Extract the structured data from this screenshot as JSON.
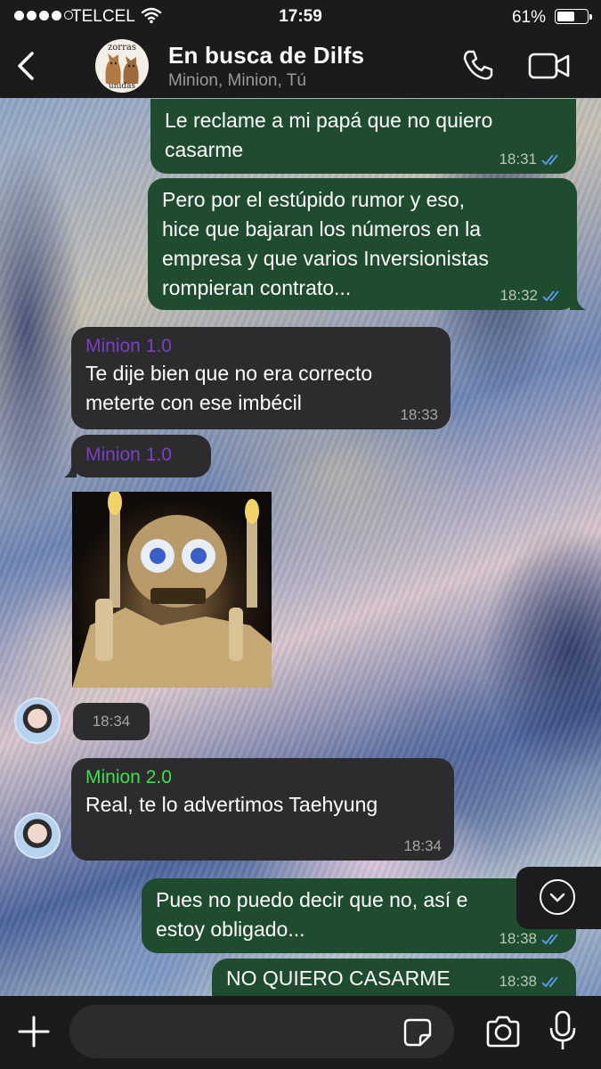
{
  "status_bar": {
    "carrier": "TELCEL",
    "time": "17:59",
    "battery_percent": "61%",
    "battery_level": 0.61,
    "signal_bars_filled": 4,
    "signal_bars_total": 5
  },
  "header": {
    "back_icon": "chevron-left-icon",
    "avatar_text_top": "zorras",
    "avatar_text_bottom": "unidas",
    "title": "En busca de Dilfs",
    "subtitle": "Minion, Minion, Tú",
    "call_icon": "phone-icon",
    "video_icon": "video-camera-icon"
  },
  "messages": [
    {
      "type": "outgoing",
      "text_lines": [
        "Le reclame a mi papá que no quiero",
        "casarme"
      ],
      "time": "18:31",
      "status": "read"
    },
    {
      "type": "outgoing",
      "text_lines": [
        "Pero por el estúpido rumor y eso,",
        "hice que bajaran los números en la",
        "empresa y que varios Inversionistas",
        "rompieran contrato..."
      ],
      "time": "18:32",
      "status": "read"
    },
    {
      "type": "incoming",
      "sender": "Minion 1.0",
      "sender_color": "#7b3fc4",
      "text_lines": [
        "Te dije bien que no era correcto",
        "meterte con ese imbécil"
      ],
      "time": "18:33"
    },
    {
      "type": "incoming-sticker",
      "sender": "Minion 1.0",
      "sender_color": "#7b3fc4",
      "time": "18:34"
    },
    {
      "type": "incoming",
      "sender": "Minion 2.0",
      "sender_color": "#3ee04a",
      "text_lines": [
        "Real, te lo advertimos Taehyung"
      ],
      "time": "18:34"
    },
    {
      "type": "outgoing",
      "text_lines": [
        "Pues no puedo decir que no, así e",
        "estoy obligado..."
      ],
      "time": "18:38",
      "status": "read"
    },
    {
      "type": "outgoing",
      "text_lines": [
        "NO QUIERO CASARME"
      ],
      "time": "18:38",
      "status": "read"
    }
  ],
  "colors": {
    "outgoing_bubble": "#1f4b2f",
    "incoming_bubble": "#2c2c2e",
    "read_ticks": "#5aa0ff",
    "bar_background": "#1b1b1b"
  },
  "input_bar": {
    "plus_icon": "plus-icon",
    "placeholder": "",
    "sticker_icon": "sticker-icon",
    "camera_icon": "camera-icon",
    "mic_icon": "microphone-icon"
  },
  "scroll_button_icon": "chevron-down-icon"
}
